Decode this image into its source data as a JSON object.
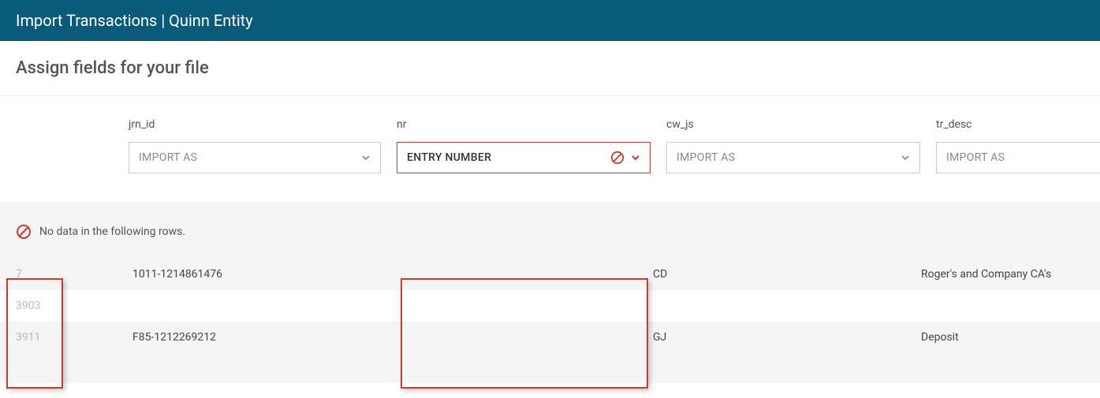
{
  "header": {
    "title": "Import Transactions | Quinn Entity"
  },
  "subheader": {
    "title": "Assign fields for your file"
  },
  "fields": [
    {
      "label": "jrn_id",
      "selected": "IMPORT AS",
      "error": false
    },
    {
      "label": "nr",
      "selected": "ENTRY NUMBER",
      "error": true
    },
    {
      "label": "cw_js",
      "selected": "IMPORT AS",
      "error": false
    },
    {
      "label": "tr_desc",
      "selected": "IMPORT AS",
      "error": false
    }
  ],
  "warning": {
    "text": "No data in the following rows."
  },
  "rows": [
    {
      "index": "7",
      "jrn_id": "1011-1214861476",
      "nr": "",
      "cw_js": "CD",
      "tr_desc": "Roger's and Company CA's"
    },
    {
      "index": "3903",
      "jrn_id": "",
      "nr": "",
      "cw_js": "",
      "tr_desc": ""
    },
    {
      "index": "3911",
      "jrn_id": "F85-1212269212",
      "nr": "",
      "cw_js": "GJ",
      "tr_desc": "Deposit"
    }
  ]
}
